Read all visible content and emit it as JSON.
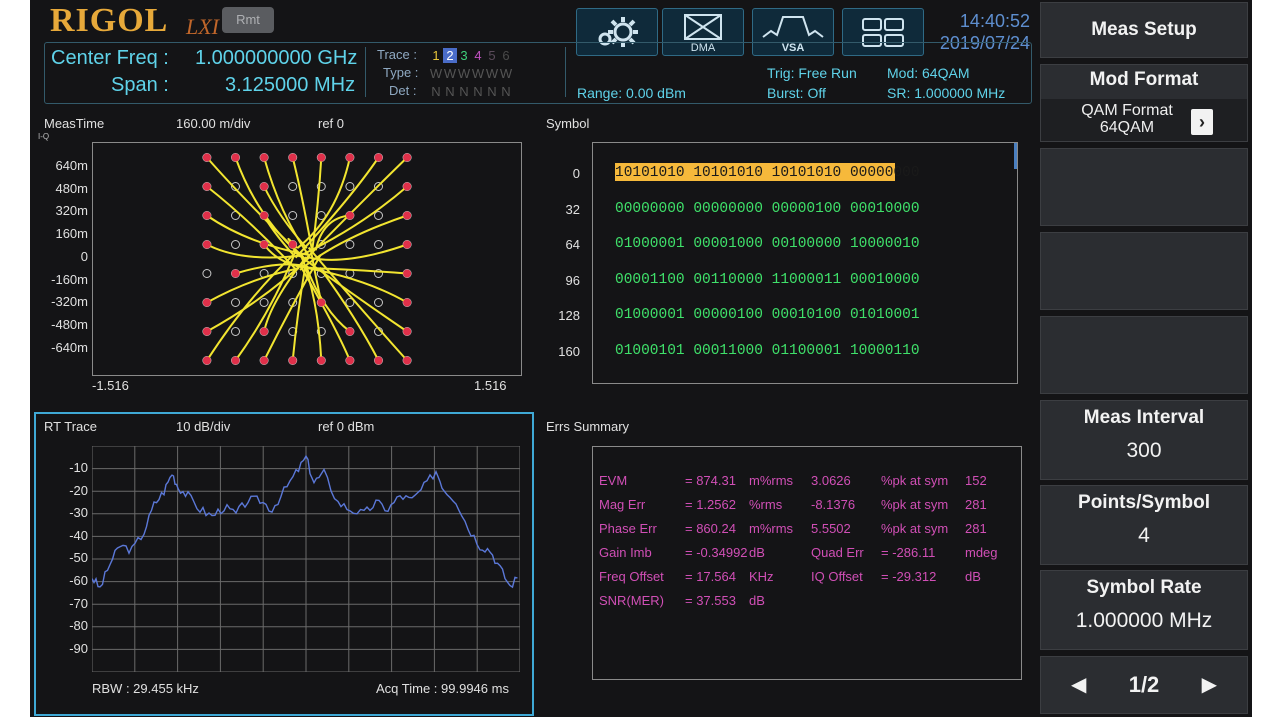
{
  "header": {
    "brand": "RIGOL",
    "lxi": "LXI",
    "rmt": "Rmt",
    "center_freq_label": "Center Freq :",
    "center_freq_value": "1.000000000 GHz",
    "span_label": "Span :",
    "span_value": "3.125000 MHz",
    "trace_label": "Trace :",
    "trace_numbers": [
      "1",
      "2",
      "3",
      "4",
      "5",
      "6"
    ],
    "type_label": "Type :",
    "type_values": [
      "W",
      "W",
      "W",
      "W",
      "W",
      "W"
    ],
    "det_label": "Det :",
    "det_values": [
      "N",
      "N",
      "N",
      "N",
      "N",
      "N"
    ],
    "range": "Range: 0.00 dBm",
    "trig": "Trig: Free Run",
    "burst": "Burst: Off",
    "mod": "Mod: 64QAM",
    "sr": "SR: 1.000000 MHz",
    "time": "14:40:52",
    "date": "2019/07/24",
    "icons": [
      {
        "name": "gear-icon",
        "label": ""
      },
      {
        "name": "dma-icon",
        "label": "DMA"
      },
      {
        "name": "vsa-icon",
        "label": "VSA"
      },
      {
        "name": "layout-grid-icon",
        "label": ""
      }
    ]
  },
  "iq": {
    "title": "MeasTime",
    "sub": "I-Q",
    "scale": "160.00 m/div",
    "ref": "ref 0",
    "y_ticks": [
      "640m",
      "480m",
      "320m",
      "160m",
      "0",
      "-160m",
      "-320m",
      "-480m",
      "-640m"
    ],
    "x_min": "-1.516",
    "x_max": "1.516"
  },
  "symbol": {
    "title": "Symbol",
    "rows": [
      {
        "index": "0",
        "bits": "10101010 10101010 10101010 00000000"
      },
      {
        "index": "32",
        "bits": "00000000 00000000 00000100 00010000"
      },
      {
        "index": "64",
        "bits": "01000001 00001000 00100000 10000010"
      },
      {
        "index": "96",
        "bits": "00001100 00110000 11000011 00010000"
      },
      {
        "index": "128",
        "bits": "01000001 00000100 00010100 01010001"
      },
      {
        "index": "160",
        "bits": "01000101 00011000 01100001 10000110"
      }
    ],
    "highlight_color": "#f6b93b"
  },
  "rt": {
    "title": "RT Trace",
    "scale": "10 dB/div",
    "ref": "ref 0 dBm",
    "y_ticks": [
      "-10",
      "-20",
      "-30",
      "-40",
      "-50",
      "-60",
      "-70",
      "-80",
      "-90"
    ],
    "rbw": "RBW : 29.455 kHz",
    "acq": "Acq Time : 99.9946 ms"
  },
  "errs": {
    "title": "Errs Summary",
    "rows": [
      [
        "EVM",
        "= 874.31",
        "m%rms",
        "3.0626",
        "%pk at sym",
        "152"
      ],
      [
        "Mag Err",
        "= 1.2562",
        "%rms",
        "-8.1376",
        "%pk at sym",
        "281"
      ],
      [
        "Phase Err",
        "= 860.24",
        "m%rms",
        "5.5502",
        "%pk at sym",
        "281"
      ],
      [
        "Gain Imb",
        "= -0.34992",
        "dB",
        "Quad Err",
        "= -286.11",
        "mdeg"
      ],
      [
        "Freq Offset",
        "= 17.564",
        "KHz",
        "IQ Offset",
        "= -29.312",
        "dB"
      ],
      [
        "SNR(MER)",
        "= 37.553",
        "dB",
        "",
        "",
        ""
      ]
    ]
  },
  "softkeys": {
    "meas_setup": "Meas Setup",
    "mod_format": "Mod Format",
    "qam_format_label": "QAM Format",
    "qam_format_value": "64QAM",
    "meas_interval": "Meas Interval",
    "meas_interval_value": "300",
    "points_symbol": "Points/Symbol",
    "points_symbol_value": "4",
    "symbol_rate": "Symbol Rate",
    "symbol_rate_value": "1.000000 MHz",
    "page": "1/2"
  },
  "colors": {
    "trace_iq": "#f2e530",
    "trace_rt": "#5b78d8",
    "accent_cyan": "#5fd3ea",
    "bits_green": "#3fe06a",
    "err_magenta": "#d14fb6"
  }
}
